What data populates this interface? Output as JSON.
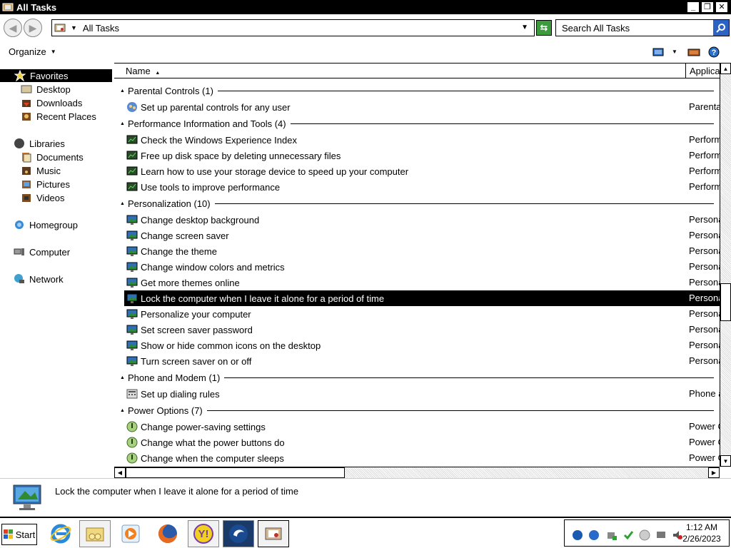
{
  "window": {
    "title": "All Tasks",
    "controls": [
      "_",
      "❐",
      "✕"
    ]
  },
  "address": {
    "path": "All Tasks",
    "search_placeholder": "Search All Tasks"
  },
  "commandbar": {
    "organize_label": "Organize"
  },
  "nav": {
    "favorites": "Favorites",
    "desktop": "Desktop",
    "downloads": "Downloads",
    "recent": "Recent Places",
    "libraries": "Libraries",
    "documents": "Documents",
    "music": "Music",
    "pictures": "Pictures",
    "videos": "Videos",
    "homegroup": "Homegroup",
    "computer": "Computer",
    "network": "Network"
  },
  "columns": {
    "name": "Name",
    "application": "Applica"
  },
  "groups": [
    {
      "title": "Parental Controls (1)",
      "items": [
        {
          "label": "Set up parental controls for any user",
          "app": "Parenta"
        }
      ]
    },
    {
      "title": "Performance Information and Tools (4)",
      "items": [
        {
          "label": "Check the Windows Experience Index",
          "app": "Perform"
        },
        {
          "label": "Free up disk space by deleting unnecessary files",
          "app": "Perform"
        },
        {
          "label": "Learn how to use your storage device to speed up your computer",
          "app": "Perform"
        },
        {
          "label": "Use tools to improve performance",
          "app": "Perform"
        }
      ]
    },
    {
      "title": "Personalization (10)",
      "items": [
        {
          "label": "Change desktop background",
          "app": "Persona"
        },
        {
          "label": "Change screen saver",
          "app": "Persona"
        },
        {
          "label": "Change the theme",
          "app": "Persona"
        },
        {
          "label": "Change window colors and metrics",
          "app": "Persona"
        },
        {
          "label": "Get more themes online",
          "app": "Persona"
        },
        {
          "label": "Lock the computer when I leave it alone for a period of time",
          "app": "Persona"
        },
        {
          "label": "Personalize your computer",
          "app": "Persona"
        },
        {
          "label": "Set screen saver password",
          "app": "Persona"
        },
        {
          "label": "Show or hide common icons on the desktop",
          "app": "Persona"
        },
        {
          "label": "Turn screen saver on or off",
          "app": "Persona"
        }
      ]
    },
    {
      "title": "Phone and Modem (1)",
      "items": [
        {
          "label": "Set up dialing rules",
          "app": "Phone a"
        }
      ]
    },
    {
      "title": "Power Options (7)",
      "items": [
        {
          "label": "Change power-saving settings",
          "app": "Power C"
        },
        {
          "label": "Change what the power buttons do",
          "app": "Power C"
        },
        {
          "label": "Change when the computer sleeps",
          "app": "Power C"
        }
      ]
    }
  ],
  "details": {
    "text": "Lock the computer when I leave it alone for a period of time"
  },
  "taskbar": {
    "start_label": "Start",
    "time": "1:12 AM",
    "date": "2/26/2023"
  }
}
